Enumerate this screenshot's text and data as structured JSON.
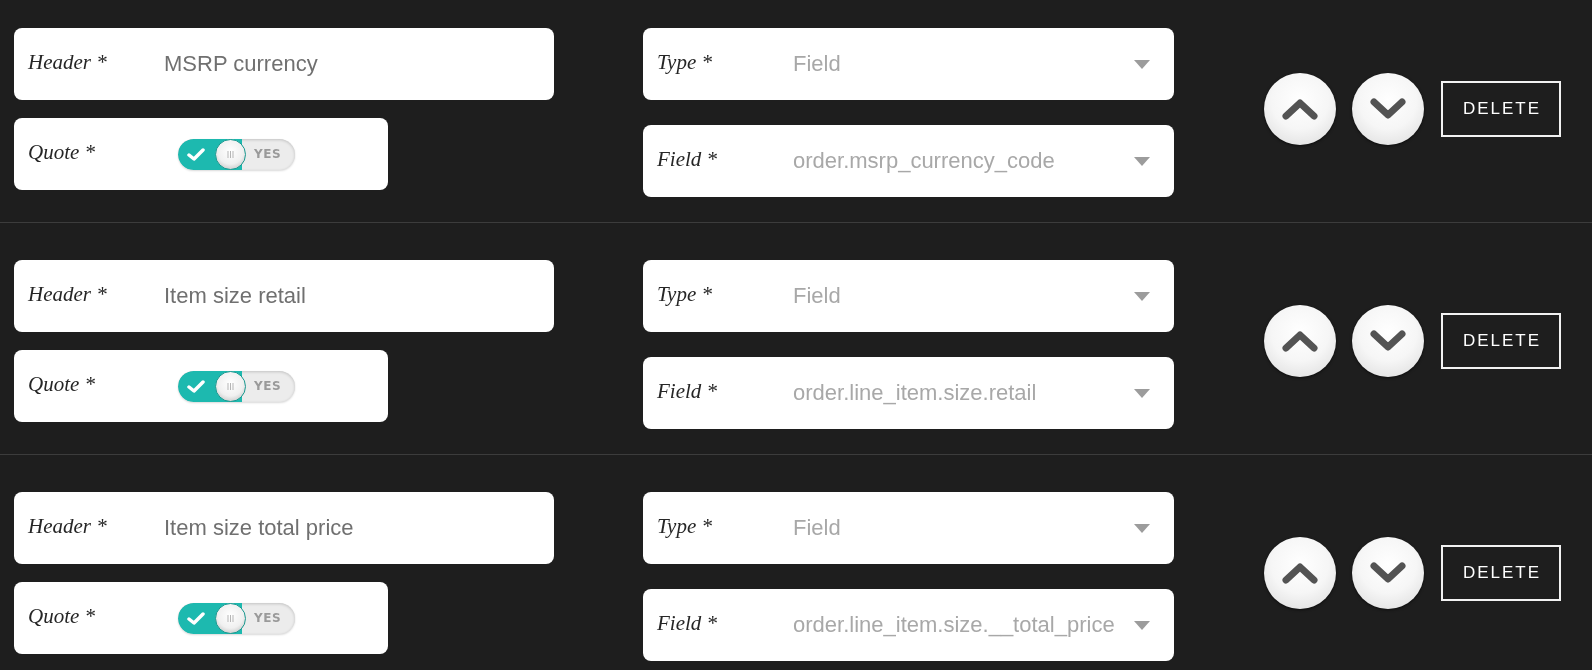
{
  "rows": [
    {
      "header": {
        "label": "Header *",
        "value": "MSRP currency"
      },
      "quote": {
        "label": "Quote *",
        "on": true,
        "text": "YES"
      },
      "type": {
        "label": "Type *",
        "value": "Field"
      },
      "field": {
        "label": "Field *",
        "value": "order.msrp_currency_code"
      },
      "delete_label": "DELETE"
    },
    {
      "header": {
        "label": "Header *",
        "value": "Item size retail"
      },
      "quote": {
        "label": "Quote *",
        "on": true,
        "text": "YES"
      },
      "type": {
        "label": "Type *",
        "value": "Field"
      },
      "field": {
        "label": "Field *",
        "value": "order.line_item.size.retail"
      },
      "delete_label": "DELETE"
    },
    {
      "header": {
        "label": "Header *",
        "value": "Item size total price"
      },
      "quote": {
        "label": "Quote *",
        "on": true,
        "text": "YES"
      },
      "type": {
        "label": "Type *",
        "value": "Field"
      },
      "field": {
        "label": "Field *",
        "value": "order.line_item.size.__total_price"
      },
      "delete_label": "DELETE"
    }
  ]
}
